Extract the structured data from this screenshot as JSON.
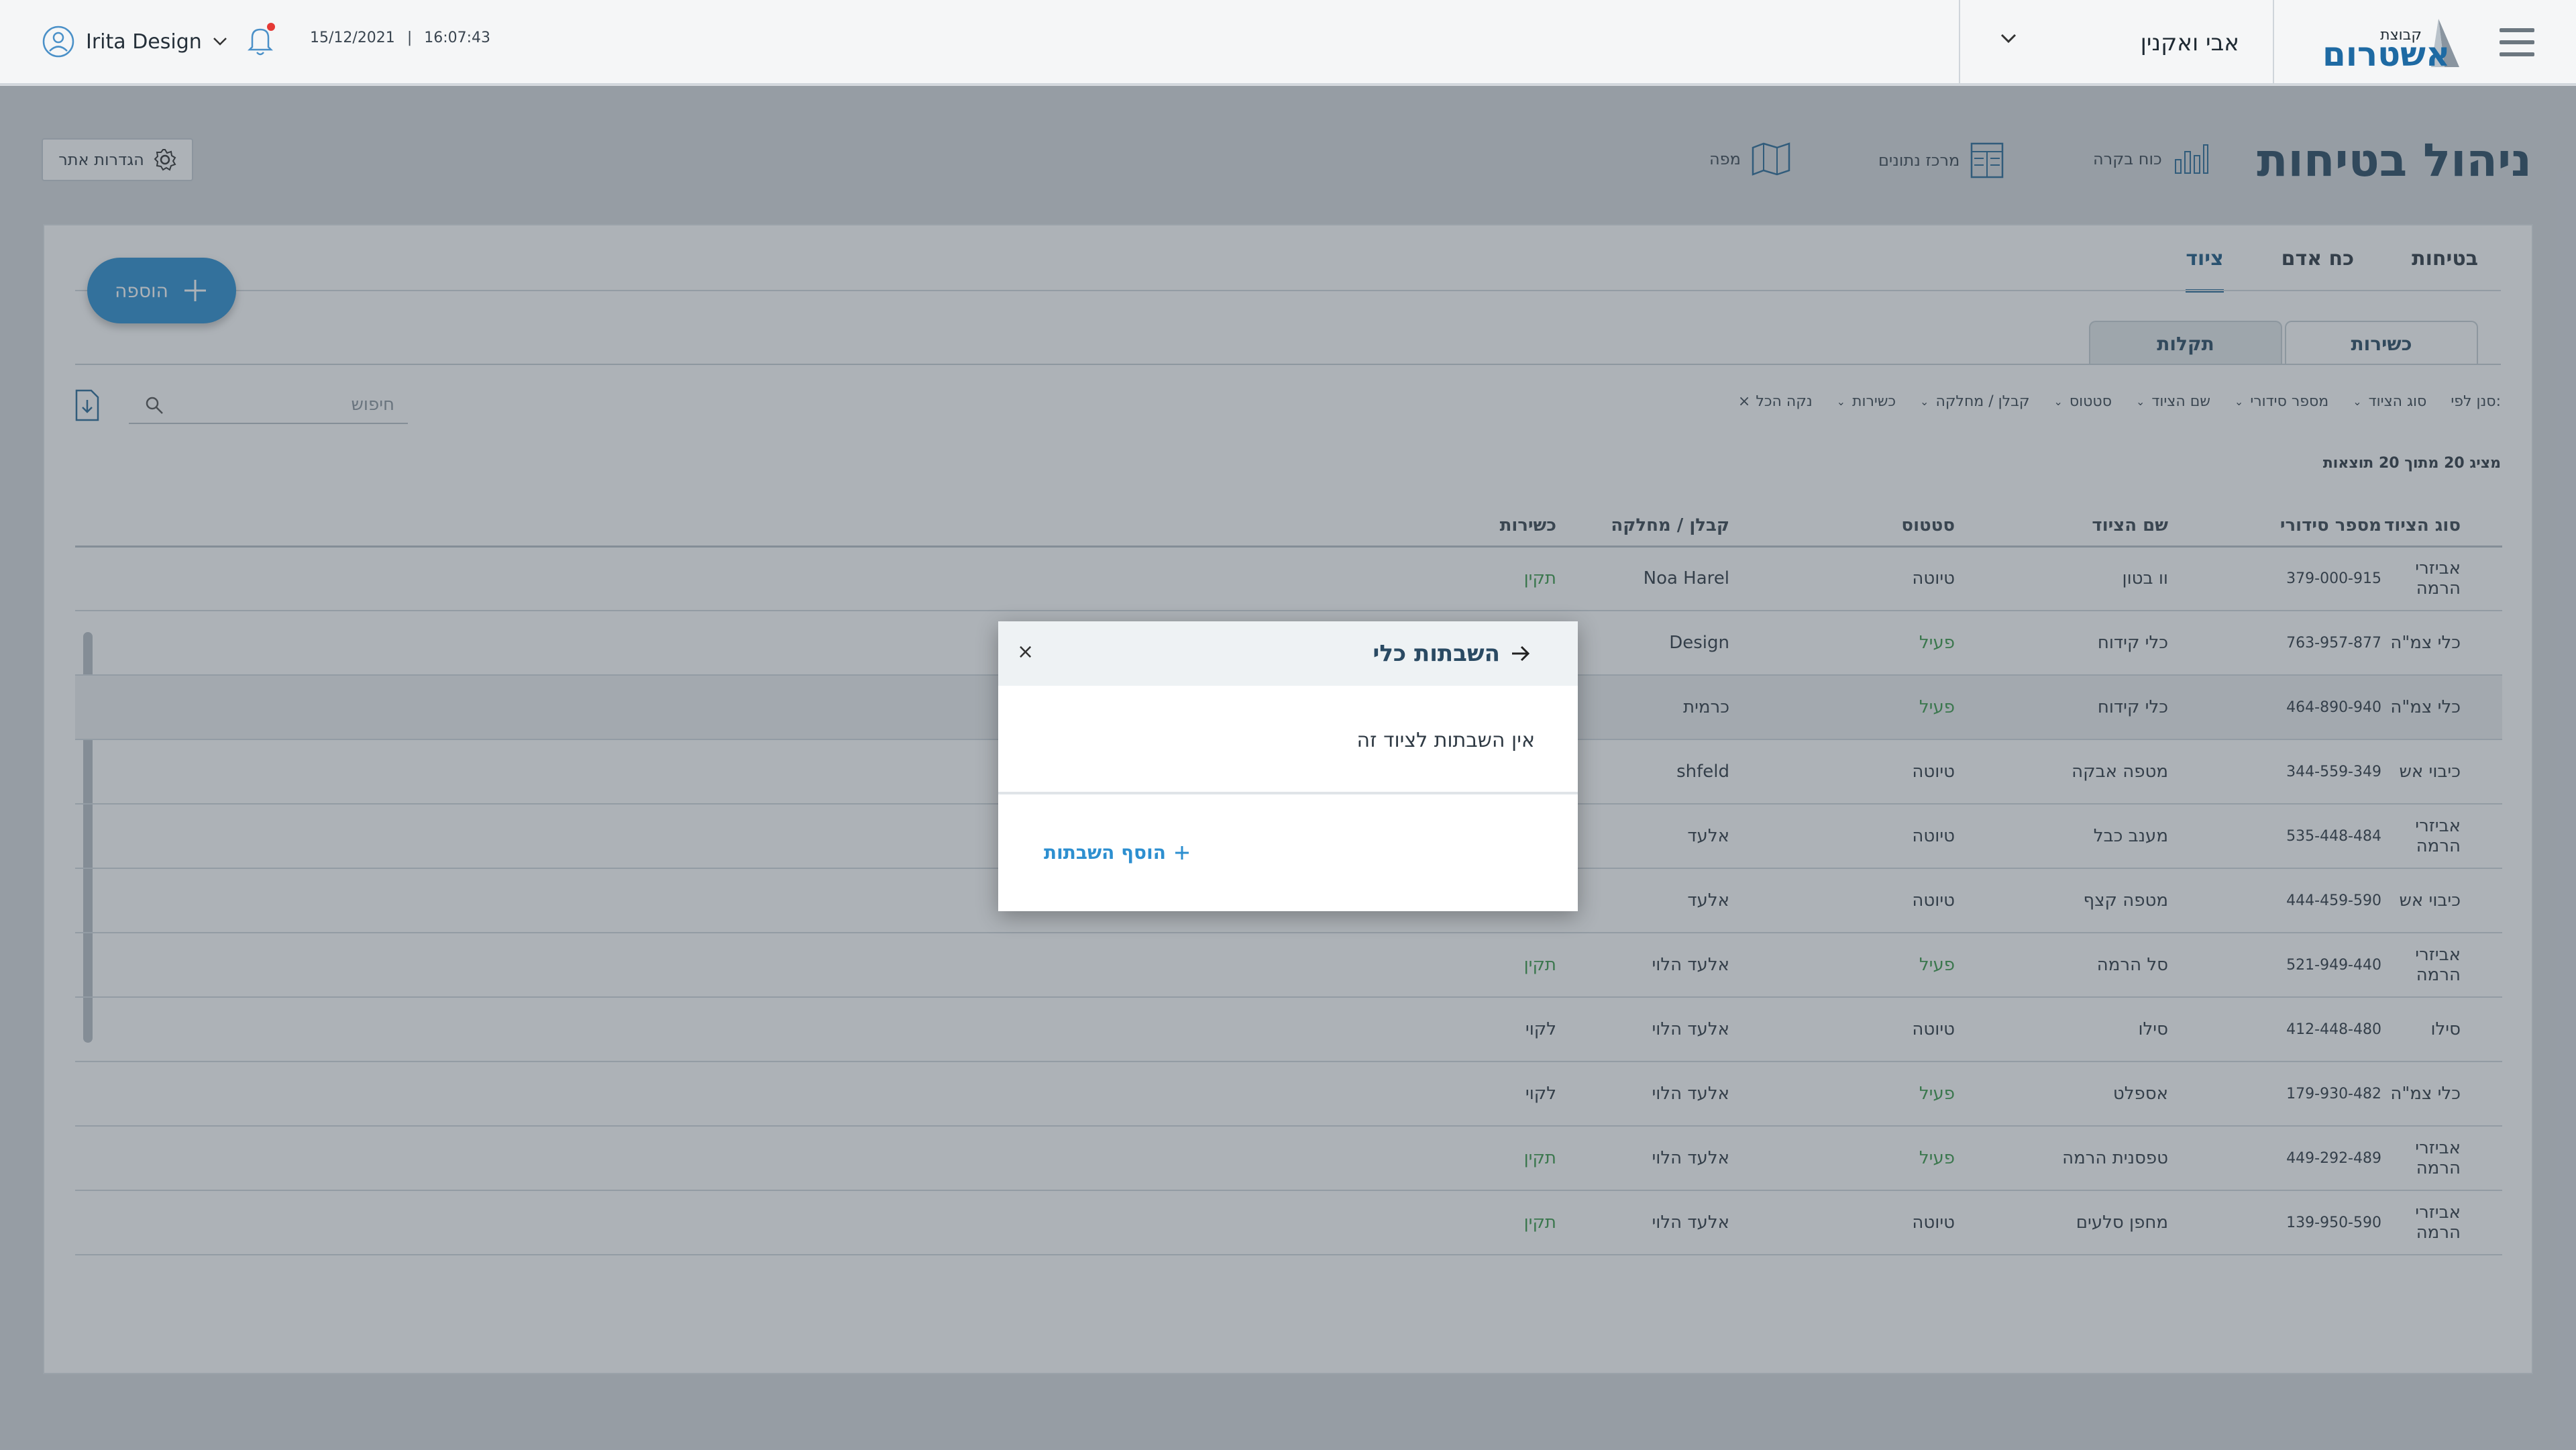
{
  "topbar": {
    "user_name": "Irita Design",
    "date": "15/12/2021",
    "separator": "|",
    "time": "16:07:43",
    "project_name": "אבי ואקנין",
    "logo_small": "קבוצת",
    "logo_big": "אשטרום"
  },
  "page": {
    "title": "ניהול בטיחות",
    "nav": [
      {
        "label": "כוח בקרה",
        "icon": "bar-chart-icon"
      },
      {
        "label": "מרכז נתונים",
        "icon": "table-icon"
      },
      {
        "label": "מפה",
        "icon": "map-icon"
      }
    ],
    "site_settings": "הגדרות אתר"
  },
  "tabs": [
    "בטיחות",
    "כח אדם",
    "ציוד"
  ],
  "active_tab": "ציוד",
  "add_button": "הוספה",
  "subtabs": [
    "כשירות",
    "תקלות"
  ],
  "filters": {
    "label": "סנן לפי:",
    "items": [
      "סוג הציוד",
      "מספר סידורי",
      "שם הציוד",
      "סטטוס",
      "קבלן / מחלקה",
      "כשירות"
    ],
    "clear": "נקה הכל"
  },
  "search_placeholder": "חיפוש",
  "results_text": "מציג 20 מתוך 20 תוצאות",
  "table": {
    "headers": [
      "סוג הציוד",
      "מספר סידורי",
      "שם הציוד",
      "סטטוס",
      "קבלן / מחלקה",
      "כשירות"
    ],
    "rows": [
      [
        "אביזרי הרמה",
        "379-000-915",
        "וו בטון",
        "טיוטה",
        "Noa Harel",
        "תקין"
      ],
      [
        "כלי צמ\"ה",
        "763-957-877",
        "כלי קידוח",
        "פעיל",
        "Design",
        ""
      ],
      [
        "כלי צמ\"ה",
        "464-890-940",
        "כלי קידוח",
        "פעיל",
        "כרמית",
        ""
      ],
      [
        "כיבוי אש",
        "344-559-349",
        "מטפה אבקה",
        "טיוטה",
        "shfeld",
        ""
      ],
      [
        "אביזרי הרמה",
        "535-448-484",
        "מענב כבל",
        "טיוטה",
        "אלעד",
        ""
      ],
      [
        "כיבוי אש",
        "444-459-590",
        "מטפה קצף",
        "טיוטה",
        "אלעד",
        ""
      ],
      [
        "אביזרי הרמה",
        "521-949-440",
        "סל הרמה",
        "פעיל",
        "אלעד הלוי",
        "תקין"
      ],
      [
        "סילו",
        "412-448-480",
        "סילו",
        "טיוטה",
        "אלעד הלוי",
        "לקוי"
      ],
      [
        "כלי צמ\"ה",
        "179-930-482",
        "אספלט",
        "פעיל",
        "אלעד הלוי",
        "לקוי"
      ],
      [
        "אביזרי הרמה",
        "449-292-489",
        "טפסנית הרמה",
        "פעיל",
        "אלעד הלוי",
        "תקין"
      ],
      [
        "אביזרי הרמה",
        "139-950-590",
        "מחפן סלעים",
        "טיוטה",
        "אלעד הלוי",
        "תקין"
      ]
    ]
  },
  "modal": {
    "title": "השבתות כלי",
    "close": "×",
    "message": "אין השבתות לציוד זה",
    "add_link": "הוסף השבתות"
  },
  "colors": {
    "accent": "#2d8fd0",
    "title": "#2a4a63",
    "active_status": "#3c9a4a",
    "overlay": "#3c4854"
  }
}
